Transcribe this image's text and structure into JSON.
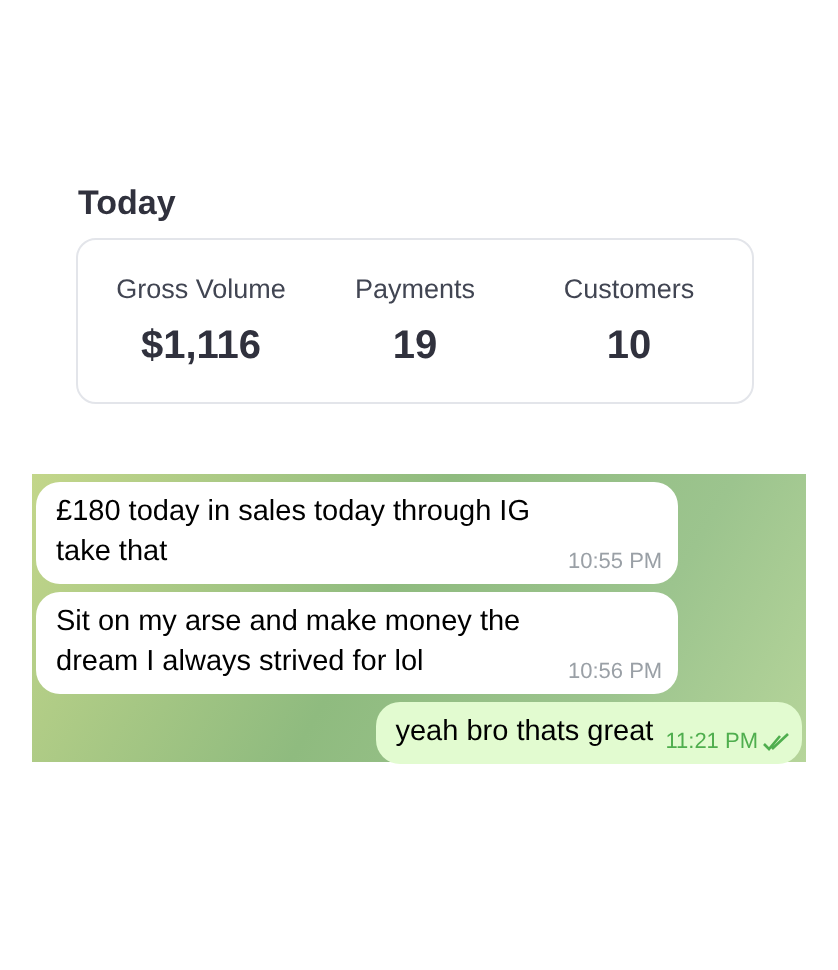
{
  "summary": {
    "title": "Today",
    "stats": [
      {
        "label": "Gross Volume",
        "value": "$1,116"
      },
      {
        "label": "Payments",
        "value": "19"
      },
      {
        "label": "Customers",
        "value": "10"
      }
    ]
  },
  "chat": {
    "messages": [
      {
        "kind": "incoming",
        "text": "£180 today in sales today through IG take that",
        "time": "10:55 PM"
      },
      {
        "kind": "incoming",
        "text": "Sit on my arse and make money the dream I always strived for lol",
        "time": "10:56 PM"
      },
      {
        "kind": "outgoing",
        "text": "yeah bro thats great",
        "time": "11:21 PM",
        "read": true
      }
    ]
  }
}
